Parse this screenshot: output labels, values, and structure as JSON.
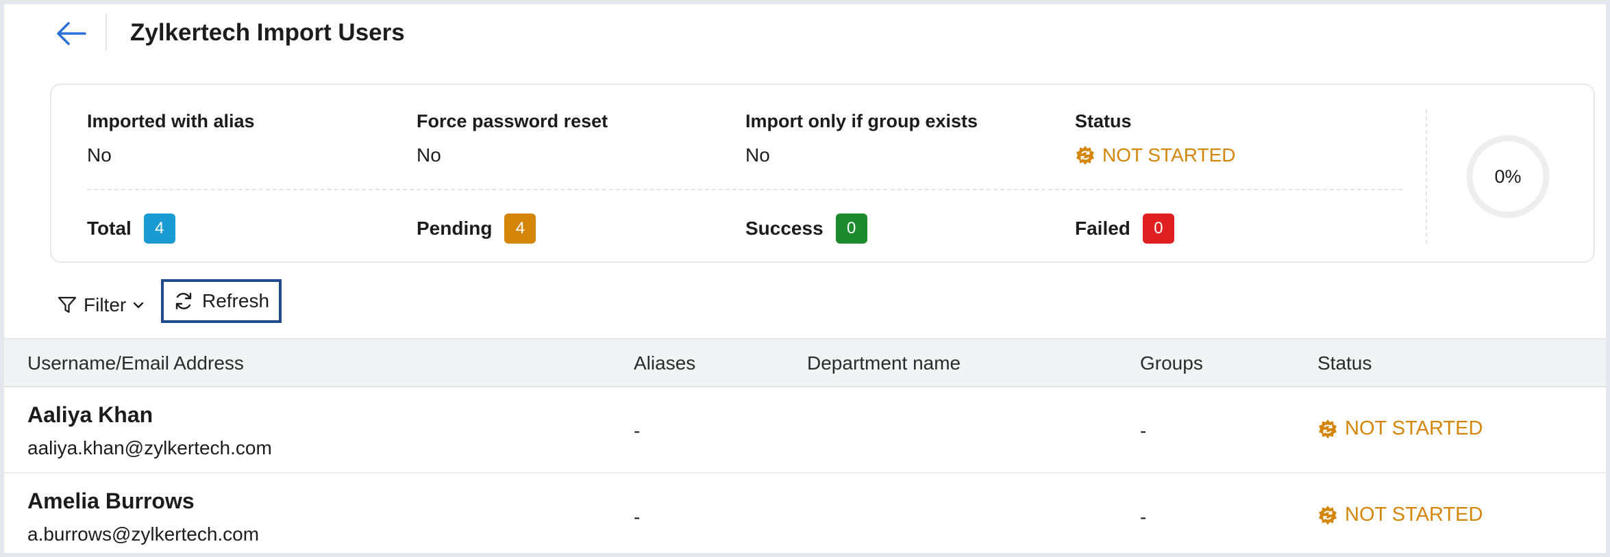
{
  "header": {
    "title": "Zylkertech Import Users"
  },
  "summary": {
    "options": [
      {
        "label": "Imported with alias",
        "value": "No"
      },
      {
        "label": "Force password reset",
        "value": "No"
      },
      {
        "label": "Import only if group exists",
        "value": "No"
      }
    ],
    "status": {
      "label": "Status",
      "value": "NOT STARTED"
    },
    "counts": [
      {
        "label": "Total",
        "value": "4",
        "color": "#1a9bd2"
      },
      {
        "label": "Pending",
        "value": "4",
        "color": "#d4860b"
      },
      {
        "label": "Success",
        "value": "0",
        "color": "#1e8a2e"
      },
      {
        "label": "Failed",
        "value": "0",
        "color": "#e02020"
      }
    ],
    "progress": "0%"
  },
  "toolbar": {
    "filter_label": "Filter",
    "refresh_label": "Refresh"
  },
  "table": {
    "columns": [
      "Username/Email Address",
      "Aliases",
      "Department name",
      "Groups",
      "Status"
    ],
    "rows": [
      {
        "name": "Aaliya Khan",
        "email": "aaliya.khan@zylkertech.com",
        "aliases": "-",
        "department": "",
        "groups": "-",
        "status": "NOT STARTED"
      },
      {
        "name": "Amelia Burrows",
        "email": "a.burrows@zylkertech.com",
        "aliases": "-",
        "department": "",
        "groups": "-",
        "status": "NOT STARTED"
      }
    ]
  },
  "colors": {
    "accent": "#2a6fd6",
    "status_not_started": "#d4860b",
    "focus_border": "#1f4b8c"
  }
}
